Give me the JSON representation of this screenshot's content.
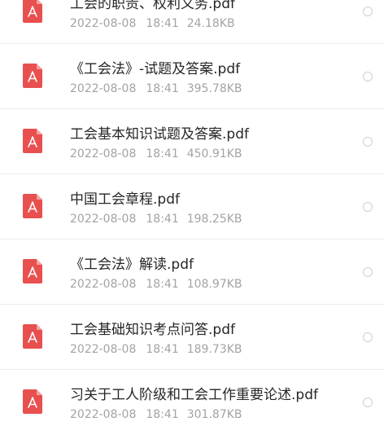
{
  "colors": {
    "pdf_icon": "#e8504f",
    "file_name_text": "#262626",
    "meta_text": "#a3a3a3",
    "divider": "#ececec",
    "radio_border": "#cfcfcf"
  },
  "files": [
    {
      "icon": "pdf-file-icon",
      "name": "工会的职责、权利义务.pdf",
      "date": "2022-08-08",
      "time": "18:41",
      "size": "24.18KB",
      "selected": false
    },
    {
      "icon": "pdf-file-icon",
      "name": "《工会法》-试题及答案.pdf",
      "date": "2022-08-08",
      "time": "18:41",
      "size": "395.78KB",
      "selected": false
    },
    {
      "icon": "pdf-file-icon",
      "name": "工会基本知识试题及答案.pdf",
      "date": "2022-08-08",
      "time": "18:41",
      "size": "450.91KB",
      "selected": false
    },
    {
      "icon": "pdf-file-icon",
      "name": "中国工会章程.pdf",
      "date": "2022-08-08",
      "time": "18:41",
      "size": "198.25KB",
      "selected": false
    },
    {
      "icon": "pdf-file-icon",
      "name": "《工会法》解读.pdf",
      "date": "2022-08-08",
      "time": "18:41",
      "size": "108.97KB",
      "selected": false
    },
    {
      "icon": "pdf-file-icon",
      "name": "工会基础知识考点问答.pdf",
      "date": "2022-08-08",
      "time": "18:41",
      "size": "189.73KB",
      "selected": false
    },
    {
      "icon": "pdf-file-icon",
      "name": "习关于工人阶级和工会工作重要论述.pdf",
      "date": "2022-08-08",
      "time": "18:41",
      "size": "301.87KB",
      "selected": false
    }
  ]
}
